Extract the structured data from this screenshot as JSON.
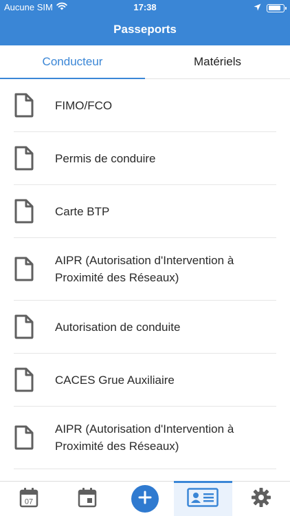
{
  "status_bar": {
    "carrier": "Aucune SIM",
    "time": "17:38",
    "battery_level": 0.85,
    "icons": [
      "wifi-icon",
      "location-icon",
      "battery-icon"
    ]
  },
  "header": {
    "title": "Passeports"
  },
  "tabs": [
    {
      "label": "Conducteur",
      "active": true
    },
    {
      "label": "Matériels",
      "active": false
    }
  ],
  "documents": [
    {
      "label": "FIMO/FCO",
      "icon": "document-icon"
    },
    {
      "label": "Permis de conduire",
      "icon": "document-icon"
    },
    {
      "label": "Carte BTP",
      "icon": "document-icon"
    },
    {
      "label": "AIPR (Autorisation d'Intervention à Proximité des Réseaux)",
      "icon": "document-icon"
    },
    {
      "label": "Autorisation de conduite",
      "icon": "document-icon"
    },
    {
      "label": "CACES Grue Auxiliaire",
      "icon": "document-icon"
    },
    {
      "label": "AIPR (Autorisation d'Intervention à Proximité des Réseaux)",
      "icon": "document-icon"
    }
  ],
  "tabbar": {
    "calendar_day": "07",
    "items": [
      "calendar-day-icon",
      "calendar-event-icon",
      "add-icon",
      "id-card-icon",
      "gear-icon"
    ],
    "selected": "id-card-icon"
  },
  "colors": {
    "primary": "#3a86d6",
    "fab": "#2f7ad0",
    "icon_gray": "#5f5f5f",
    "divider": "#e6e6e6"
  }
}
